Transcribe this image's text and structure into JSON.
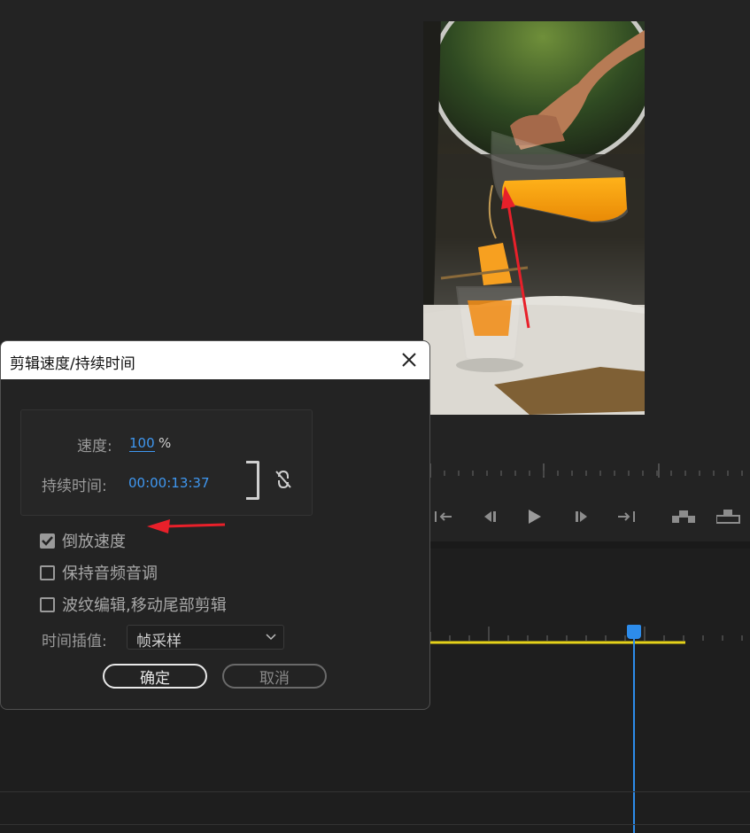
{
  "dialog": {
    "title": "剪辑速度/持续时间",
    "speed_label": "速度:",
    "speed_value": "100",
    "speed_unit": "%",
    "duration_label": "持续时间:",
    "duration_value": "00:00:13:37",
    "checkboxes": [
      {
        "label": "倒放速度",
        "checked": true
      },
      {
        "label": "保持音频音调",
        "checked": false
      },
      {
        "label": "波纹编辑,移动尾部剪辑",
        "checked": false
      }
    ],
    "interp_label": "时间插值:",
    "interp_value": "帧采样",
    "ok_label": "确定",
    "cancel_label": "取消"
  },
  "colors": {
    "accent_blue": "#3f97f0",
    "playhead": "#2d8ceb",
    "work_area": "#e5d21a",
    "annotation_red": "#e8202a"
  },
  "icons": [
    "close-icon",
    "unlink-icon",
    "step-back-icon",
    "play-icon",
    "step-forward-icon",
    "go-to-out-icon",
    "go-to-in-icon",
    "insert-icon",
    "overwrite-icon",
    "chevron-down-icon"
  ]
}
